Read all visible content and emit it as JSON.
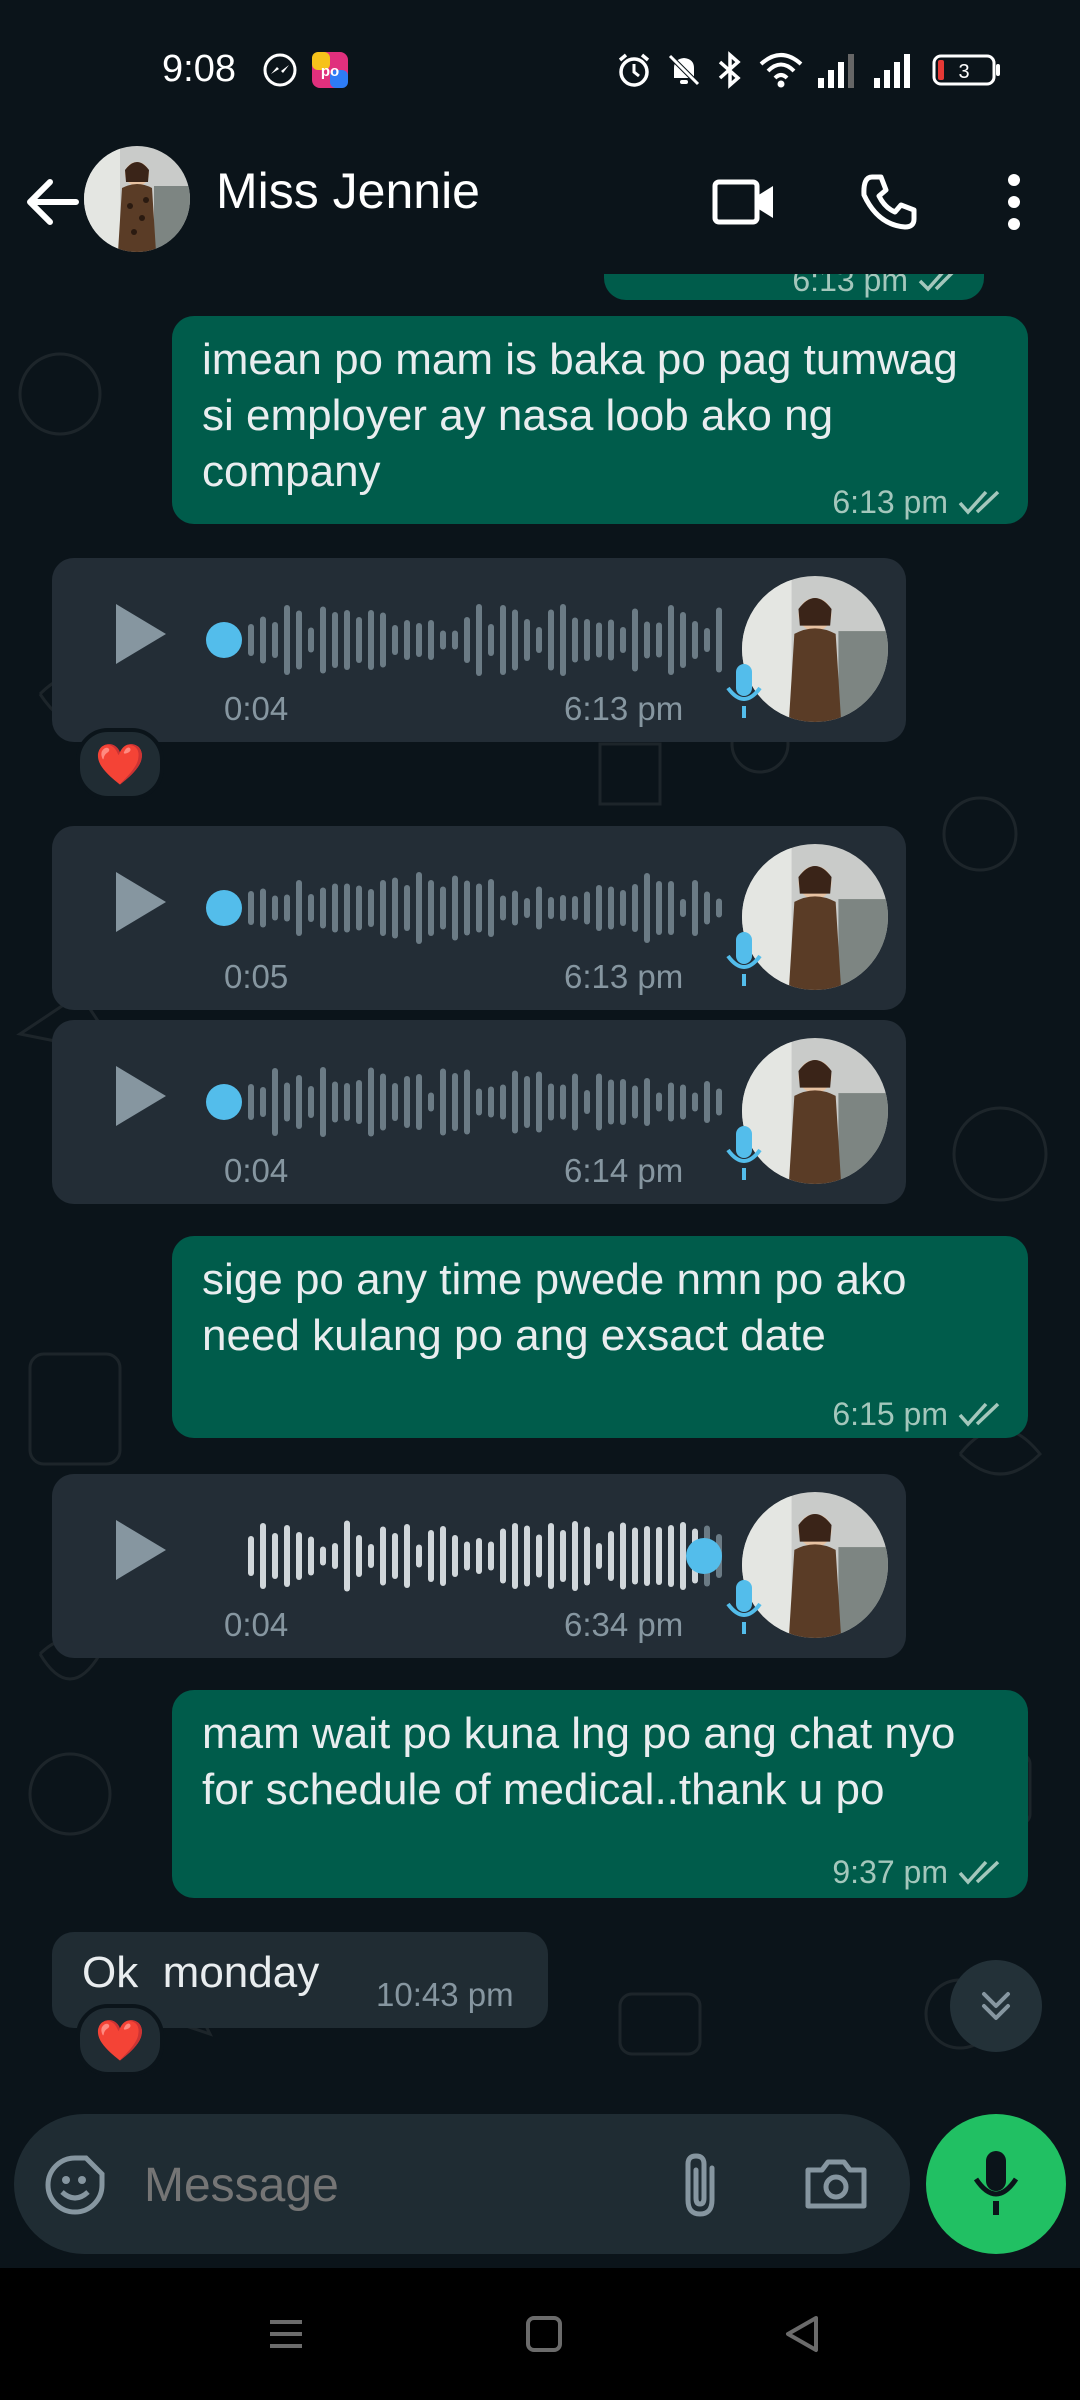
{
  "status_bar": {
    "time": "9:08",
    "battery": "3",
    "icons": [
      "messenger-icon",
      "app-icon",
      "alarm-icon",
      "mute-icon",
      "bluetooth-icon",
      "wifi-icon",
      "signal-icon",
      "signal-icon",
      "battery-icon"
    ]
  },
  "header": {
    "contact_name": "Miss Jennie",
    "actions": [
      "video-call-icon",
      "voice-call-icon",
      "more-options-icon"
    ]
  },
  "messages": [
    {
      "type": "outgoing-text",
      "text": "imean po mam is baka po pag tumwag si employer ay nasa loob ako ng company",
      "time": "6:13 pm",
      "status": "read"
    },
    {
      "type": "incoming-voice",
      "duration": "0:04",
      "time": "6:13 pm",
      "reaction": "❤️"
    },
    {
      "type": "incoming-voice",
      "duration": "0:05",
      "time": "6:13 pm"
    },
    {
      "type": "incoming-voice",
      "duration": "0:04",
      "time": "6:14 pm"
    },
    {
      "type": "outgoing-text",
      "text": "sige po any time pwede nmn po ako need kulang po ang exsact date",
      "time": "6:15 pm",
      "status": "read"
    },
    {
      "type": "incoming-voice",
      "duration": "0:04",
      "time": "6:34 pm",
      "played_fraction": 0.95
    },
    {
      "type": "outgoing-text",
      "text": "mam wait po kuna lng po ang chat nyo for schedule of medical..thank u po",
      "time": "9:37 pm",
      "status": "read"
    },
    {
      "type": "incoming-text",
      "text": "Ok  monday",
      "time": "10:43 pm",
      "reaction": "❤️"
    }
  ],
  "partial_top_message": {
    "time": "6:13 pm"
  },
  "composer": {
    "placeholder": "Message",
    "icons": [
      "emoji-sticker-icon",
      "attach-icon",
      "camera-icon",
      "mic-icon"
    ]
  },
  "colors": {
    "background": "#0b141a",
    "outgoing_bubble": "#005c4b",
    "incoming_bubble": "#202c33",
    "accent_green": "#21c063",
    "read_tick": "#a4c7bc",
    "voice_dot": "#53bdeb"
  }
}
